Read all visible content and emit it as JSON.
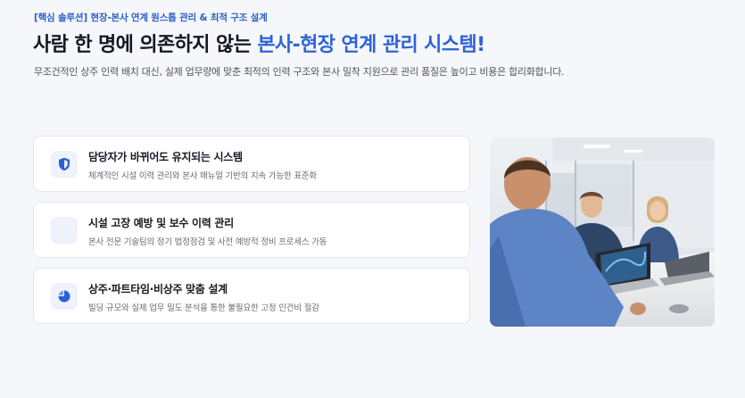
{
  "hero": {
    "eyebrow": "[핵심 솔루션] 현장-본사 연계 원스톱 관리 & 최적 구조 설계",
    "headline_plain": "사람 한 명에 의존하지 않는 ",
    "headline_accent": "본사-현장 연계 관리 시스템!",
    "subtitle": "무조건적인 상주 인력 배치 대신, 실제 업무량에 맞춘 최적의 인력 구조와 본사 밀착 지원으로 관리 품질은 높이고 비용은 합리화합니다."
  },
  "features": [
    {
      "icon": "shield-icon",
      "title": "담당자가 바뀌어도 유지되는 시스템",
      "description": "체계적인 시설 이력 관리와 본사 매뉴얼 기반의 지속 가능한 표준화"
    },
    {
      "icon": "wrench-icon",
      "title": "시설 고장 예방 및 보수 이력 관리",
      "description": "본사 전문 기술팀의 정기 법정점검 및 사전 예방적 정비 프로세스 가동"
    },
    {
      "icon": "pie-chart-icon",
      "title": "상주·파트타임·비상주 맞춤 설계",
      "description": "빌딩 규모와 실제 업무 밀도 분석을 통한 불필요한 고정 인건비 절감"
    }
  ],
  "colors": {
    "accent": "#2e63d9",
    "icon": "#2b5fd6",
    "background": "#f6f7fa"
  }
}
